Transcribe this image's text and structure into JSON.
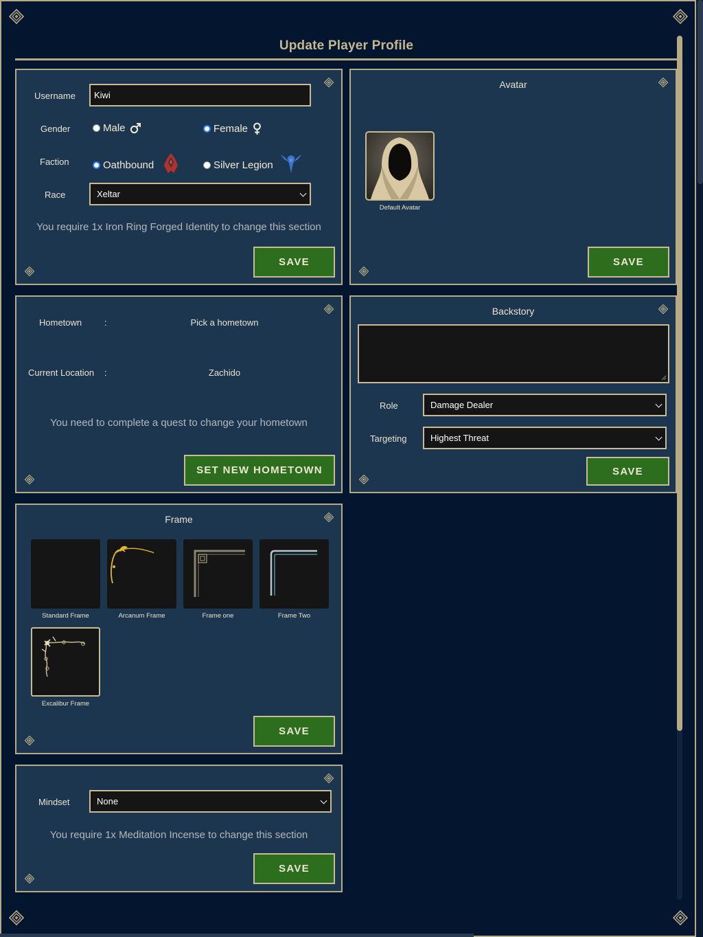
{
  "page": {
    "title": "Update Player Profile"
  },
  "identity": {
    "username_label": "Username",
    "username_value": "Kiwi",
    "gender_label": "Gender",
    "gender_male": "Male",
    "gender_female": "Female",
    "faction_label": "Faction",
    "faction_oathbound": "Oathbound",
    "faction_silver": "Silver Legion",
    "race_label": "Race",
    "race_value": "Xeltar",
    "requirement": "You require 1x Iron Ring Forged Identity to change this section",
    "save_label": "SAVE"
  },
  "avatar": {
    "title": "Avatar",
    "caption": "Default Avatar",
    "save_label": "SAVE"
  },
  "hometown": {
    "hometown_label": "Hometown",
    "hometown_sep": ":",
    "hometown_value": "Pick a hometown",
    "location_label": "Current Location",
    "location_sep": ":",
    "location_value": "Zachido",
    "note": "You need to complete a quest to change your hometown",
    "button_label": "SET NEW HOMETOWN"
  },
  "backstory": {
    "title": "Backstory",
    "role_label": "Role",
    "role_value": "Damage Dealer",
    "targeting_label": "Targeting",
    "targeting_value": "Highest Threat",
    "save_label": "SAVE"
  },
  "frame": {
    "title": "Frame",
    "items": [
      {
        "label": "Standard Frame"
      },
      {
        "label": "Arcanum Frame"
      },
      {
        "label": "Frame one"
      },
      {
        "label": "Frame Two"
      },
      {
        "label": "Excalibur Frame"
      }
    ],
    "save_label": "SAVE"
  },
  "mindset": {
    "label": "Mindset",
    "value": "None",
    "requirement": "You require 1x Meditation Incense to change this section",
    "save_label": "SAVE"
  },
  "colors": {
    "background": "#041530",
    "panel": "#1d364f",
    "border": "#b7ab86",
    "button": "#2c6e1e",
    "title": "#c4b88e"
  }
}
